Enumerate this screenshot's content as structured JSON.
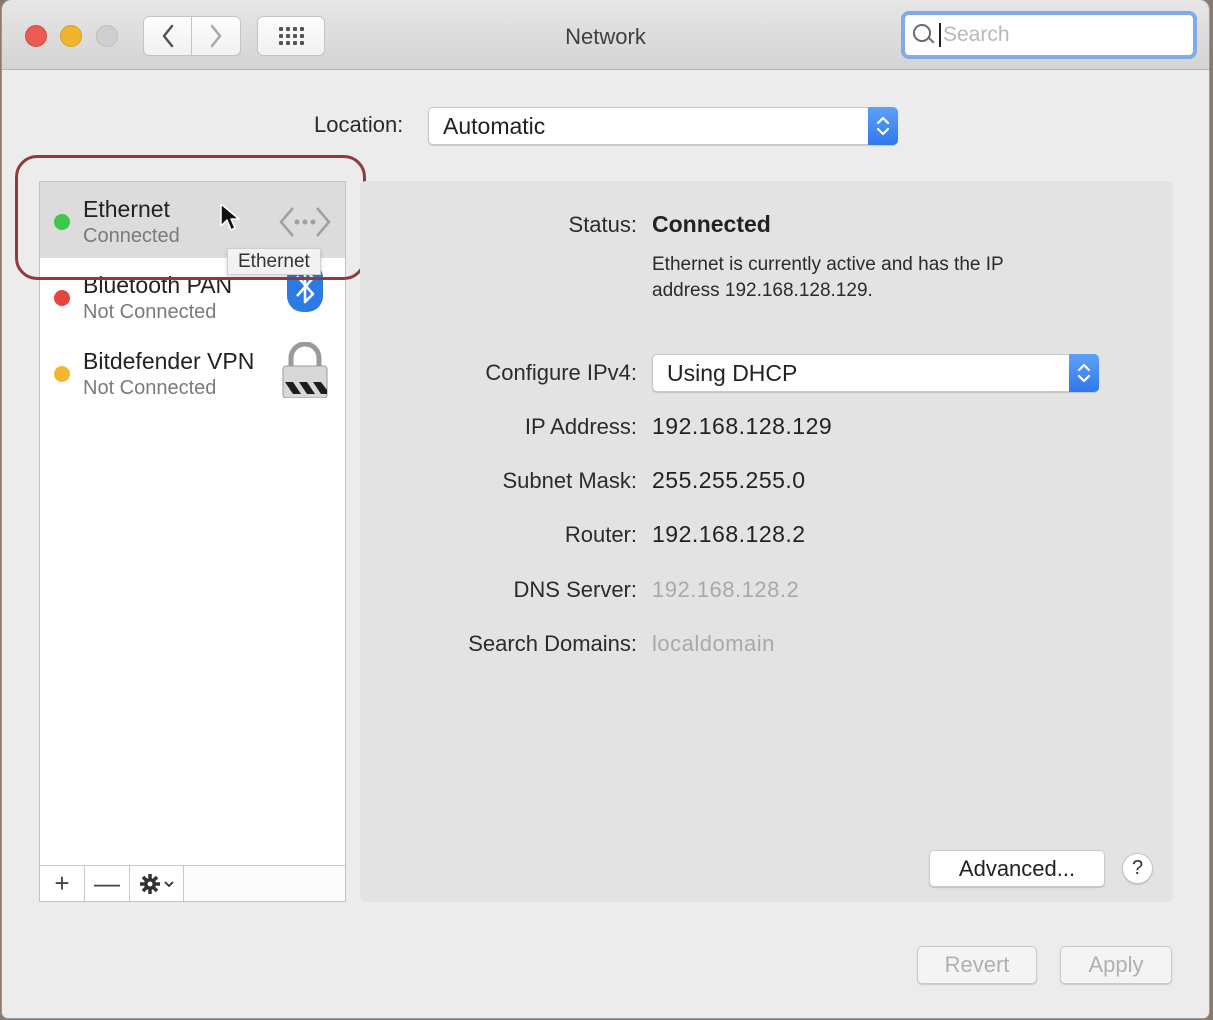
{
  "window": {
    "title": "Network",
    "search_placeholder": "Search"
  },
  "location": {
    "label": "Location:",
    "value": "Automatic"
  },
  "services": [
    {
      "name": "Ethernet",
      "status": "Connected",
      "dot_color": "#3cc84a",
      "icon": "ethernet-icon"
    },
    {
      "name": "Bluetooth PAN",
      "status": "Not Connected",
      "dot_color": "#e8433f",
      "icon": "bluetooth-icon"
    },
    {
      "name": "Bitdefender VPN",
      "status": "Not Connected",
      "dot_color": "#f5b731",
      "icon": "vpn-lock-icon"
    }
  ],
  "tooltip": "Ethernet",
  "sidebar_controls": {
    "add": "+",
    "remove": "—"
  },
  "detail": {
    "status_label": "Status:",
    "status_value": "Connected",
    "status_description": "Ethernet is currently active and has the IP address 192.168.128.129.",
    "configure_label": "Configure IPv4:",
    "configure_value": "Using DHCP",
    "ip_label": "IP Address:",
    "ip_value": "192.168.128.129",
    "subnet_label": "Subnet Mask:",
    "subnet_value": "255.255.255.0",
    "router_label": "Router:",
    "router_value": "192.168.128.2",
    "dns_label": "DNS Server:",
    "dns_value": "192.168.128.2",
    "domains_label": "Search Domains:",
    "domains_value": "localdomain"
  },
  "buttons": {
    "advanced": "Advanced...",
    "help": "?",
    "revert": "Revert",
    "apply": "Apply"
  },
  "colors": {
    "accent": "#2f78ec",
    "highlight_ring": "#8e3b3b"
  }
}
